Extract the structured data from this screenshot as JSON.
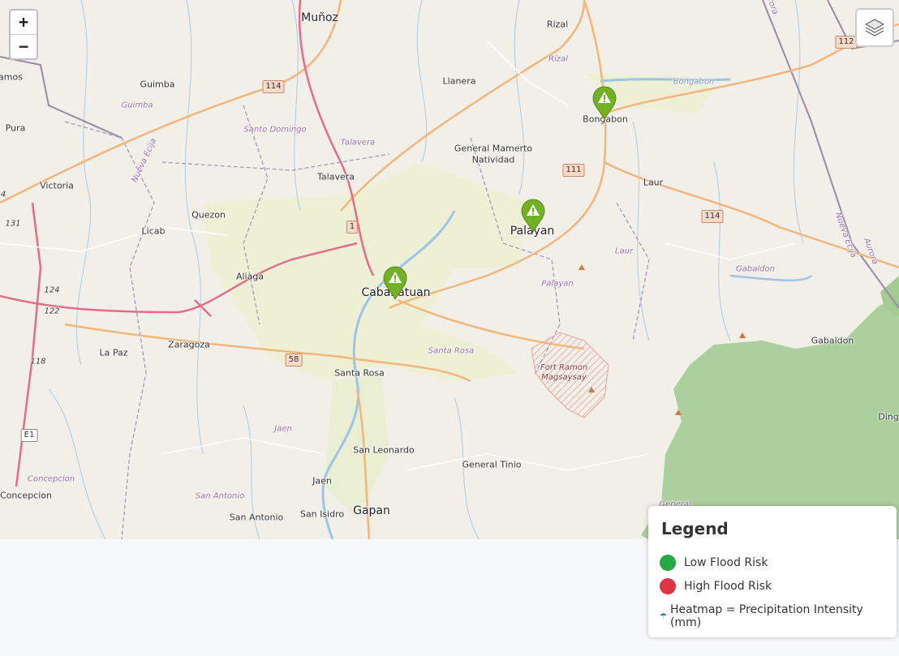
{
  "controls": {
    "zoom_in": "+",
    "zoom_out": "−",
    "layers_icon": "layers-icon"
  },
  "places": {
    "munoz": "Muñoz",
    "rizal": "Rizal",
    "guimba": "Guimba",
    "llanera": "Llanera",
    "bongabon": "Bongabon",
    "pura": "Pura",
    "amos": "amos",
    "gen_mamerto": "General Mamerto",
    "natividad": "Natividad",
    "talavera": "Talavera",
    "victoria": "Victoria",
    "quezon": "Quezon",
    "laur": "Laur",
    "licab": "Licab",
    "palayan": "Palayan",
    "aliaga": "Aliaga",
    "cabanatuan": "Cabanatuan",
    "la_paz": "La Paz",
    "zaragoza": "Zaragoza",
    "santa_rosa": "Santa Rosa",
    "gabaldon": "Gabaldon",
    "ding": "Ding",
    "san_leonardo": "San Leonardo",
    "general_tinio": "General Tinio",
    "jaen": "Jaen",
    "concepcion": "Concepcion",
    "san_antonio": "San Antonio",
    "san_isidro": "San Isidro",
    "gapan": "Gapan"
  },
  "admin_labels": {
    "guimba": "Guimba",
    "santo_domingo": "Santo Domingo",
    "talavera": "Talavera",
    "rizal": "Rizal",
    "nueva_ecija_w": "Nueva Ecija",
    "nueva_ecija_e": "Nueva Ecija",
    "aurora_top": "rora",
    "aurora_e": "Aurora",
    "laur": "Laur",
    "gabaldon": "Gabaldon",
    "palayan": "Palayan",
    "santa_rosa": "Santa Rosa",
    "jaen": "Jaen",
    "concepcion": "Concepcion",
    "san_antonio": "San Antonio",
    "general": "General"
  },
  "water_labels": {
    "bongabon": "Bongabon"
  },
  "protected_area": {
    "line1": "Fort Ramon",
    "line2": "Magsaysay"
  },
  "road_shields": {
    "r114a": "114",
    "r112": "112",
    "r111": "111",
    "r114b": "114",
    "r1": "1",
    "r58": "58",
    "r124": "124",
    "r122": "122",
    "r118": "118",
    "r131": "131",
    "r4": "4",
    "e1": "E1"
  },
  "markers": [
    {
      "name": "Bongabon",
      "risk": "low",
      "icon": "warning-icon",
      "color": "#72b026"
    },
    {
      "name": "Palayan",
      "risk": "low",
      "icon": "warning-icon",
      "color": "#72b026"
    },
    {
      "name": "Cabanatuan",
      "risk": "low",
      "icon": "warning-icon",
      "color": "#72b026"
    }
  ],
  "legend": {
    "title": "Legend",
    "low": {
      "label": "Low Flood Risk",
      "color": "#28a745"
    },
    "high": {
      "label": "High Flood Risk",
      "color": "#dc3545"
    },
    "heatmap": {
      "label": "Heatmap = Precipitation Intensity (mm)",
      "icon": "raindrop-icon"
    }
  }
}
